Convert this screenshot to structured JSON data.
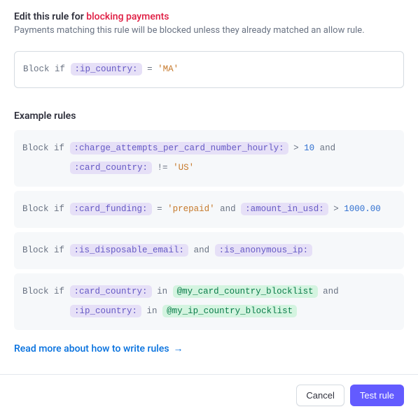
{
  "header": {
    "title_prefix": "Edit this rule for ",
    "title_highlight": "blocking payments",
    "description": "Payments matching this rule will be blocked unless they already matched an allow rule."
  },
  "editor": {
    "block_if": "Block if",
    "var_ip_country": ":ip_country:",
    "op_eq": "=",
    "val_ma": "'MA'"
  },
  "examples": {
    "title": "Example rules",
    "r1": {
      "block_if": "Block if",
      "var_charge": ":charge_attempts_per_card_number_hourly:",
      "op_gt": ">",
      "val_10": "10",
      "and": "and",
      "var_card_country": ":card_country:",
      "op_neq": "!=",
      "val_us": "'US'"
    },
    "r2": {
      "block_if": "Block if",
      "var_card_funding": ":card_funding:",
      "op_eq": "=",
      "val_prepaid": "'prepaid'",
      "and": "and",
      "var_amount": ":amount_in_usd:",
      "op_gt": ">",
      "val_1000": "1000.00"
    },
    "r3": {
      "block_if": "Block if",
      "var_disposable": ":is_disposable_email:",
      "and": "and",
      "var_anon": ":is_anonymous_ip:"
    },
    "r4": {
      "block_if": "Block if",
      "var_card_country": ":card_country:",
      "in1": "in",
      "list_card": "@my_card_country_blocklist",
      "and": "and",
      "var_ip_country": ":ip_country:",
      "in2": "in",
      "list_ip": "@my_ip_country_blocklist"
    }
  },
  "read_more": {
    "label": "Read more about how to write rules",
    "arrow": "→"
  },
  "footer": {
    "cancel": "Cancel",
    "test": "Test rule"
  }
}
